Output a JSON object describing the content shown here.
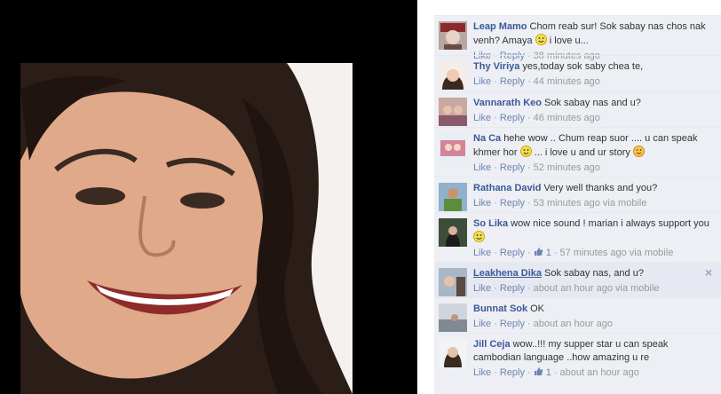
{
  "comments": [
    {
      "author": "Leap Mamo",
      "text_before": "Chom reab sur! Sok sabay nas chos nak venh? Amaya ",
      "emoji_1": "smiley",
      "text_after": " i love u...",
      "like": "Like",
      "reply": "Reply",
      "meta": "38 minutes ago"
    },
    {
      "author": "Thy Viriya",
      "text_before": "yes,today sok saby chea te,",
      "like": "Like",
      "reply": "Reply",
      "meta": "44 minutes ago"
    },
    {
      "author": "Vannarath Keo",
      "text_before": "Sok sabay nas and u?",
      "like": "Like",
      "reply": "Reply",
      "meta": "46 minutes ago"
    },
    {
      "author": "Na Ca",
      "text_before": "hehe wow .. Chum reap suor .... u can speak khmer hor ",
      "emoji_1": "smiley",
      "text_middle": " ... i love u and ur story ",
      "emoji_2": "wink",
      "like": "Like",
      "reply": "Reply",
      "meta": "52 minutes ago"
    },
    {
      "author": "Rathana David",
      "text_before": "Very well thanks and you?",
      "like": "Like",
      "reply": "Reply",
      "meta": "53 minutes ago via mobile"
    },
    {
      "author": "So Lika",
      "text_before": "wow nice sound ! marian i always support you ",
      "emoji_1": "smiley",
      "like": "Like",
      "reply": "Reply",
      "likes_count": "1",
      "meta": "57 minutes ago via mobile"
    },
    {
      "author": "Leakhena Dika",
      "text_before": "Sok sabay nas, and u?",
      "like": "Like",
      "reply": "Reply",
      "meta": "about an hour ago via mobile",
      "close": "×"
    },
    {
      "author": "Bunnat Sok",
      "text_before": "OK",
      "like": "Like",
      "reply": "Reply",
      "meta": "about an hour ago"
    },
    {
      "author": "Jill Ceja",
      "text_before": "wow..!!! my supper star u can speak cambodian language ..how amazing u re",
      "like": "Like",
      "reply": "Reply",
      "likes_count": "1",
      "meta": "about an hour ago"
    }
  ],
  "separator": "·",
  "colors": {
    "link": "#3b5998",
    "action_link": "#6d84b4",
    "panel_bg": "#edeff4",
    "highlight_bg": "#e6e9f1"
  }
}
